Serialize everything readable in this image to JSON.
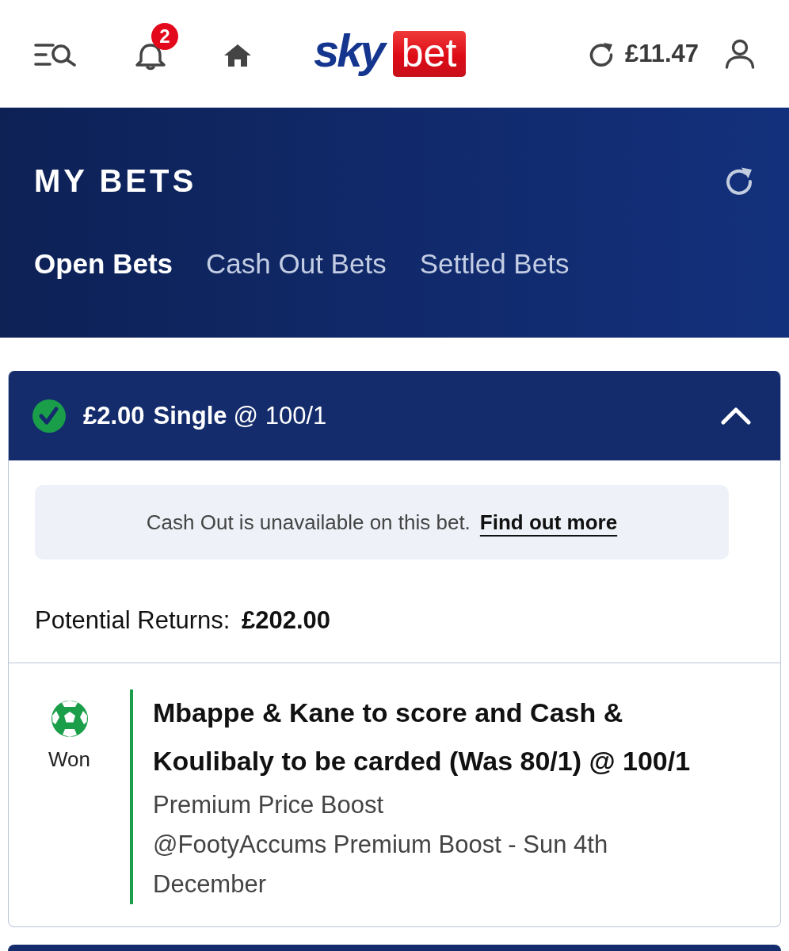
{
  "header": {
    "notification_count": "2",
    "logo": {
      "part_1": "sky",
      "part_2": "bet"
    },
    "balance": "£11.47"
  },
  "page": {
    "title": "MY BETS",
    "tabs": [
      {
        "label": "Open Bets",
        "selected": true
      },
      {
        "label": "Cash Out Bets",
        "selected": false
      },
      {
        "label": "Settled Bets",
        "selected": false
      }
    ]
  },
  "bets": [
    {
      "won": true,
      "expanded": true,
      "stake": "£2.00",
      "bet_type": "Single",
      "odds": "@ 100/1",
      "cash_out_notice": {
        "text": "Cash Out is unavailable on this bet.",
        "link": "Find out more"
      },
      "potential_returns_label": "Potential Returns:",
      "potential_returns": "£202.00",
      "selections": [
        {
          "won": true,
          "status": "Won",
          "title": "Mbappe & Kane to score and Cash & Koulibaly to be carded (Was 80/1) @ 100/1",
          "market": "Premium Price Boost",
          "event": "@FootyAccums Premium Boost - Sun 4th December"
        }
      ]
    }
  ]
}
